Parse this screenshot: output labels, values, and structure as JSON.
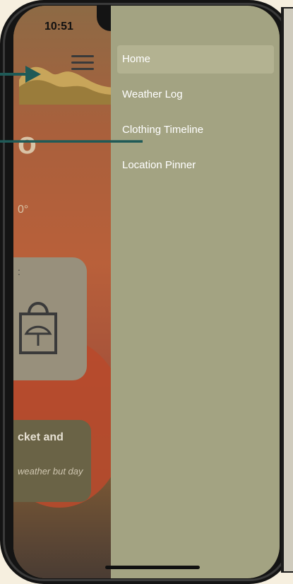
{
  "status_bar": {
    "time": "10:51"
  },
  "background_app": {
    "title_fragment": "o",
    "temperature_fragment": "0°",
    "card_label_fragment": ":",
    "recommendation_title": "cket and",
    "recommendation_body": "weather but day"
  },
  "drawer": {
    "items": [
      {
        "label": "Home",
        "active": true
      },
      {
        "label": "Weather Log",
        "active": false
      },
      {
        "label": "Clothing Timeline",
        "active": false
      },
      {
        "label": "Location Pinner",
        "active": false
      }
    ]
  },
  "colors": {
    "drawer_bg": "#a3a382",
    "drawer_active": "#b3b291",
    "annotation_arrow": "#1f5a57",
    "page_bg": "#f6efdf"
  },
  "icons": [
    "hamburger-menu-icon",
    "wifi-icon",
    "battery-icon",
    "signal-icon",
    "clothing-bag-icon"
  ]
}
